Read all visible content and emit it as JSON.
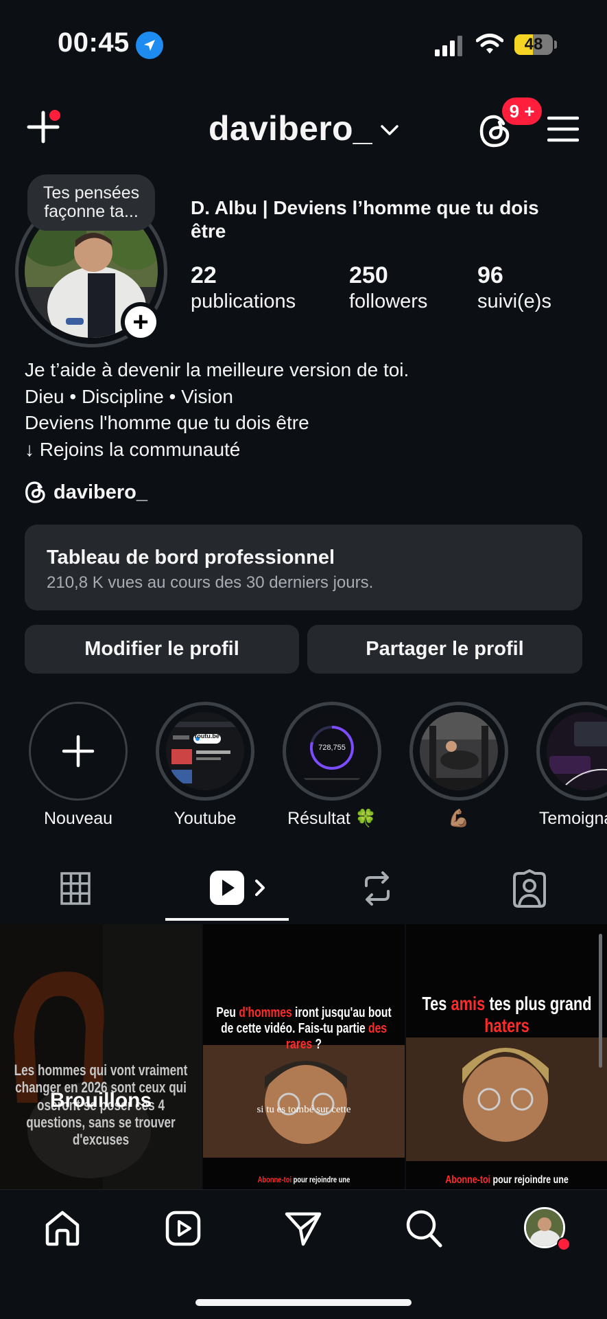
{
  "status_bar": {
    "time": "00:45",
    "battery": "48",
    "battery_level": 0.48
  },
  "header": {
    "username": "davibero_",
    "notifications_badge": "9 +"
  },
  "profile": {
    "note_bubble": "Tes pensées façonne ta...",
    "full_name": "D. Albu | Deviens l’homme que tu dois être",
    "stats": [
      {
        "value": "22",
        "label": "publications"
      },
      {
        "value": "250",
        "label": "followers"
      },
      {
        "value": "96",
        "label": "suivi(e)s"
      }
    ],
    "bio": [
      "Je t’aide à devenir la meilleure version de toi.",
      "Dieu • Discipline • Vision",
      "Deviens l'homme que tu dois être",
      "↓ Rejoins la communauté"
    ],
    "threads_handle": "davibero_"
  },
  "dashboard": {
    "title": "Tableau de bord professionnel",
    "subtitle": "210,8 K vues au cours des 30 derniers jours."
  },
  "buttons": {
    "edit": "Modifier le profil",
    "share": "Partager le profil"
  },
  "highlights": [
    {
      "label": "Nouveau"
    },
    {
      "label": "Youtube",
      "thumb_text": "Youtu.be"
    },
    {
      "label": "Résultat 🍀",
      "thumb_text": "728,755"
    },
    {
      "label": "💪🏽"
    },
    {
      "label": "Temoignage"
    }
  ],
  "grid": {
    "drafts_label": "Brouillons",
    "posts": [
      {
        "caption": "Les hommes qui vont vraiment changer en 2026 sont ceux qui oseront se poser ces 4 questions, sans se trouver d'excuses"
      },
      {
        "caption_top_1": "Peu ",
        "caption_top_red_1": "d'hommes",
        "caption_top_2": " iront jusqu'au bout de cette vidéo. Fais-tu partie ",
        "caption_top_red_2": "des rares",
        "caption_top_3": " ?",
        "caption_mid": "si tu es tombé sur cette",
        "caption_bottom_red": "Abonne-toi",
        "caption_bottom": " pour rejoindre une"
      },
      {
        "caption_top_1": "Tes ",
        "caption_top_red_1": "amis",
        "caption_top_2": " tes plus grand ",
        "caption_top_red_2": "haters",
        "caption_bottom_red": "Abonne-toi",
        "caption_bottom": " pour rejoindre une"
      }
    ]
  },
  "colors": {
    "background": "#0c1014",
    "card": "#25292e",
    "accent_red": "#ff1f3d",
    "location_blue": "#1e8bf0",
    "battery_yellow": "#f5d424"
  }
}
